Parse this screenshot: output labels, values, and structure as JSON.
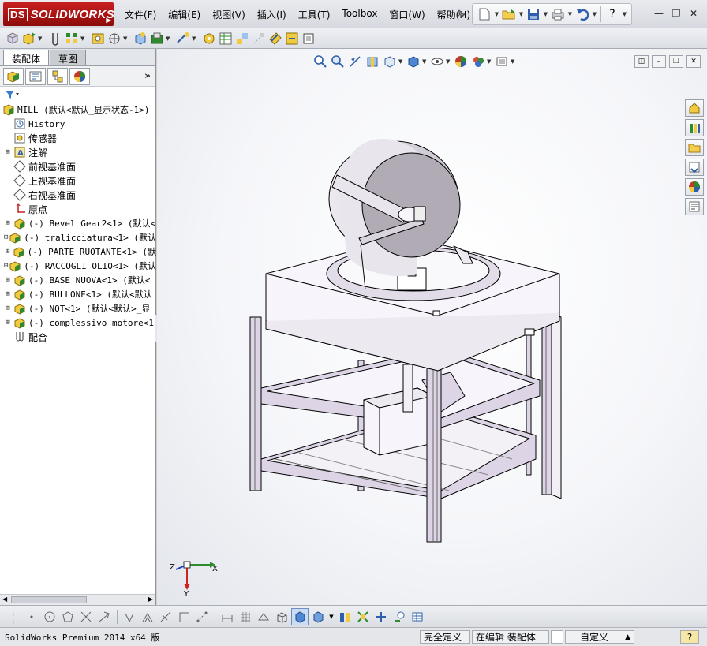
{
  "app": {
    "brand": "SOLIDWORKS",
    "brand_prefix": "DS"
  },
  "menu": [
    "文件(F)",
    "编辑(E)",
    "视图(V)",
    "插入(I)",
    "工具(T)",
    "Toolbox",
    "窗口(W)",
    "帮助(H)"
  ],
  "window_controls": {
    "minimize": "—",
    "restore": "❐",
    "close": "✕",
    "help": "?"
  },
  "feature_manager": {
    "tabs": [
      "装配体",
      "草图"
    ],
    "expand_symbol": "»",
    "tree": [
      {
        "label": "MILL  (默认<默认_显示状态-1>)",
        "icon": "assembly-icon",
        "expandable": false,
        "indent": 0,
        "cn": false
      },
      {
        "label": "History",
        "icon": "history-icon",
        "expandable": false,
        "indent": 1,
        "cn": false
      },
      {
        "label": "传感器",
        "icon": "sensor-icon",
        "expandable": false,
        "indent": 1,
        "cn": true
      },
      {
        "label": "注解",
        "icon": "annotation-icon",
        "expandable": true,
        "indent": 1,
        "cn": true
      },
      {
        "label": "前视基准面",
        "icon": "plane-icon",
        "expandable": false,
        "indent": 1,
        "cn": true
      },
      {
        "label": "上视基准面",
        "icon": "plane-icon",
        "expandable": false,
        "indent": 1,
        "cn": true
      },
      {
        "label": "右视基准面",
        "icon": "plane-icon",
        "expandable": false,
        "indent": 1,
        "cn": true
      },
      {
        "label": "原点",
        "icon": "origin-icon",
        "expandable": false,
        "indent": 1,
        "cn": true
      },
      {
        "label": "(-) Bevel Gear2<1> (默认<",
        "icon": "subassembly-icon",
        "expandable": true,
        "indent": 1,
        "cn": false
      },
      {
        "label": "(-) tralicciatura<1> (默认",
        "icon": "subassembly-icon",
        "expandable": true,
        "indent": 1,
        "cn": false
      },
      {
        "label": "(-) PARTE RUOTANTE<1> (默",
        "icon": "subassembly-icon",
        "expandable": true,
        "indent": 1,
        "cn": false
      },
      {
        "label": "(-) RACCOGLI OLIO<1> (默认",
        "icon": "subassembly-icon",
        "expandable": true,
        "indent": 1,
        "cn": false
      },
      {
        "label": "(-) BASE NUOVA<1> (默认<",
        "icon": "subassembly-icon",
        "expandable": true,
        "indent": 1,
        "cn": false
      },
      {
        "label": "(-) BULLONE<1> (默认<默认",
        "icon": "subassembly-icon",
        "expandable": true,
        "indent": 1,
        "cn": false
      },
      {
        "label": "(-) NOT<1> (默认<默认>_显",
        "icon": "subassembly-icon",
        "expandable": true,
        "indent": 1,
        "cn": false
      },
      {
        "label": "(-) complessivo motore<1",
        "icon": "subassembly-icon",
        "expandable": true,
        "indent": 1,
        "cn": false
      },
      {
        "label": "配合",
        "icon": "mates-icon",
        "expandable": false,
        "indent": 1,
        "cn": true
      }
    ]
  },
  "triad": {
    "x": "X",
    "y": "Y",
    "z": "Z"
  },
  "status": {
    "product": "SolidWorks Premium 2014 x64 版",
    "definition": "完全定义",
    "mode": "在编辑 装配体",
    "units": "自定义",
    "units_arrow": "▲",
    "help": "?"
  },
  "colors": {
    "model_face": "#f7f5fb",
    "frame": "#ddd4e6",
    "disc": "#b1abb6",
    "accent_red": "#c81e1e"
  }
}
